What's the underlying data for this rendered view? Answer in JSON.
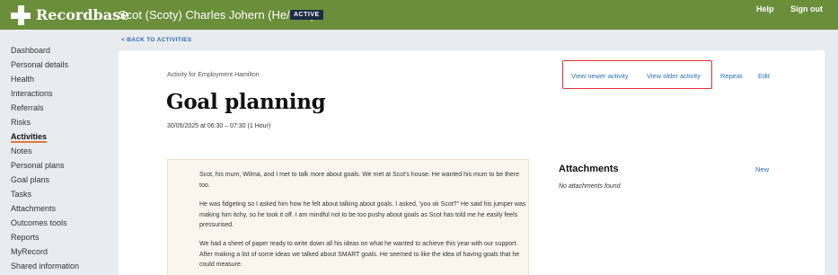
{
  "app": {
    "name": "Recordbase"
  },
  "header": {
    "person_name": "Scot (Scoty) Charles Johern (He/Him)",
    "status_badge": "ACTIVE",
    "help": "Help",
    "sign_out": "Sign out"
  },
  "sidebar": {
    "items": [
      {
        "label": "Dashboard"
      },
      {
        "label": "Personal details"
      },
      {
        "label": "Health"
      },
      {
        "label": "Interactions"
      },
      {
        "label": "Referrals"
      },
      {
        "label": "Risks"
      },
      {
        "label": "Activities",
        "active": true
      },
      {
        "label": "Notes"
      },
      {
        "label": "Personal plans"
      },
      {
        "label": "Goal plans"
      },
      {
        "label": "Tasks"
      },
      {
        "label": "Attachments"
      },
      {
        "label": "Outcomes tools"
      },
      {
        "label": "Reports"
      },
      {
        "label": "MyRecord"
      },
      {
        "label": "Shared information"
      }
    ]
  },
  "back_link": "< BACK TO ACTIVITIES",
  "activity": {
    "for": "Activity for Employment Hamilton",
    "title": "Goal planning",
    "datetime": "30/05/2025 at 06:30 – 07:30 (1 Hour)"
  },
  "actions": {
    "view_newer": "View newer activity",
    "view_older": "View older activity",
    "repeat": "Repeat",
    "edit": "Edit"
  },
  "notes": [
    "Scot, his mum, Wilma, and I met to talk more about goals. We met at Scot's house. He wanted his mum to be there too.",
    "He was fidgeting so I asked him how he felt about talking about goals. I asked, 'you ok Scot?\" He said his jumper was making him itchy, so he took it off. I am mindful not to be too pushy about goals as Scot has told me he easily feels pressurised.",
    "We had a sheet of paper ready to write down all his ideas on what he wanted to achieve this year with our support. After making a list of some ideas we talked about SMART goals. He seemed to like the idea of having goals that he could measure."
  ],
  "attachments": {
    "title": "Attachments",
    "new_label": "New",
    "empty_text": "No attachments found"
  },
  "colors": {
    "header_bg": "#6b8e3a",
    "link": "#2a6ebb",
    "active_underline": "#e07b39",
    "highlight_border": "#e03030",
    "badge_bg": "#1f2a44"
  }
}
